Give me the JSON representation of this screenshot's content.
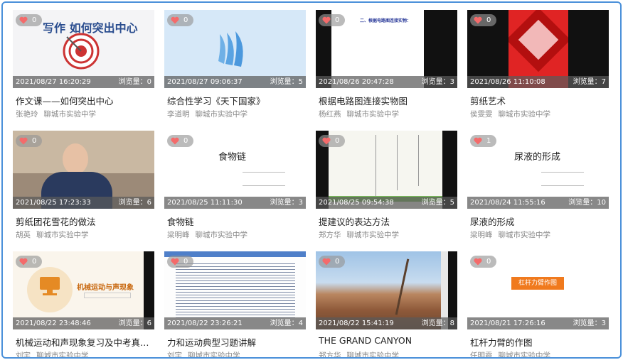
{
  "colors": {
    "frame_border": "#4a90d9",
    "heart": "#f46b6b",
    "overlay": "#5a5a5a"
  },
  "cards": [
    {
      "title": "作文课——如何突出中心",
      "author": "张艳玲",
      "school": "聊城市实验中学",
      "date": "2021/08/27 16:20:29",
      "views": "浏览量：0",
      "likes": "0",
      "thumb_text": "写作 如何突出中心"
    },
    {
      "title": "综合性学习《天下国家》",
      "author": "李道明",
      "school": "聊城市实验中学",
      "date": "2021/08/27 09:06:37",
      "views": "浏览量：5",
      "likes": "0",
      "thumb_text": ""
    },
    {
      "title": "根据电路图连接实物图",
      "author": "杨红燕",
      "school": "聊城市实验中学",
      "date": "2021/08/26 20:47:28",
      "views": "浏览量：3",
      "likes": "0",
      "thumb_text": "二、根据电路图连接实物："
    },
    {
      "title": "剪纸艺术",
      "author": "侯雯雯",
      "school": "聊城市实验中学",
      "date": "2021/08/26 11:10:08",
      "views": "浏览量：7",
      "likes": "0",
      "thumb_text": ""
    },
    {
      "title": "剪纸团花雪花的做法",
      "author": "胡英",
      "school": "聊城市实验中学",
      "date": "2021/08/25 17:23:33",
      "views": "浏览量：6",
      "likes": "0",
      "thumb_text": ""
    },
    {
      "title": "食物链",
      "author": "梁明峰",
      "school": "聊城市实验中学",
      "date": "2021/08/25 11:11:30",
      "views": "浏览量：3",
      "likes": "0",
      "thumb_text": "食物链"
    },
    {
      "title": "提建议的表达方法",
      "author": "郑方华",
      "school": "聊城市实验中学",
      "date": "2021/08/25 09:54:38",
      "views": "浏览量：5",
      "likes": "0",
      "thumb_text": ""
    },
    {
      "title": "尿液的形成",
      "author": "梁明峰",
      "school": "聊城市实验中学",
      "date": "2021/08/24 11:55:16",
      "views": "浏览量：10",
      "likes": "1",
      "thumb_text": "尿液的形成"
    },
    {
      "title": "机械运动和声现象复习及中考真题...",
      "author": "刘宇",
      "school": "聊城市实验中学",
      "date": "2021/08/22 23:48:46",
      "views": "浏览量：6",
      "likes": "0",
      "thumb_text": "机械运动与声现象"
    },
    {
      "title": "力和运动典型习题讲解",
      "author": "刘宇",
      "school": "聊城市实验中学",
      "date": "2021/08/22 23:26:21",
      "views": "浏览量：4",
      "likes": "0",
      "thumb_text": ""
    },
    {
      "title": "THE GRAND CANYON",
      "author": "郑方华",
      "school": "聊城市实验中学",
      "date": "2021/08/22 15:41:19",
      "views": "浏览量：8",
      "likes": "0",
      "thumb_text": ""
    },
    {
      "title": "杠杆力臂的作图",
      "author": "任明霞",
      "school": "聊城市实验中学",
      "date": "2021/08/21 17:26:16",
      "views": "浏览量：3",
      "likes": "0",
      "thumb_text": "杠杆力臂作图"
    }
  ]
}
